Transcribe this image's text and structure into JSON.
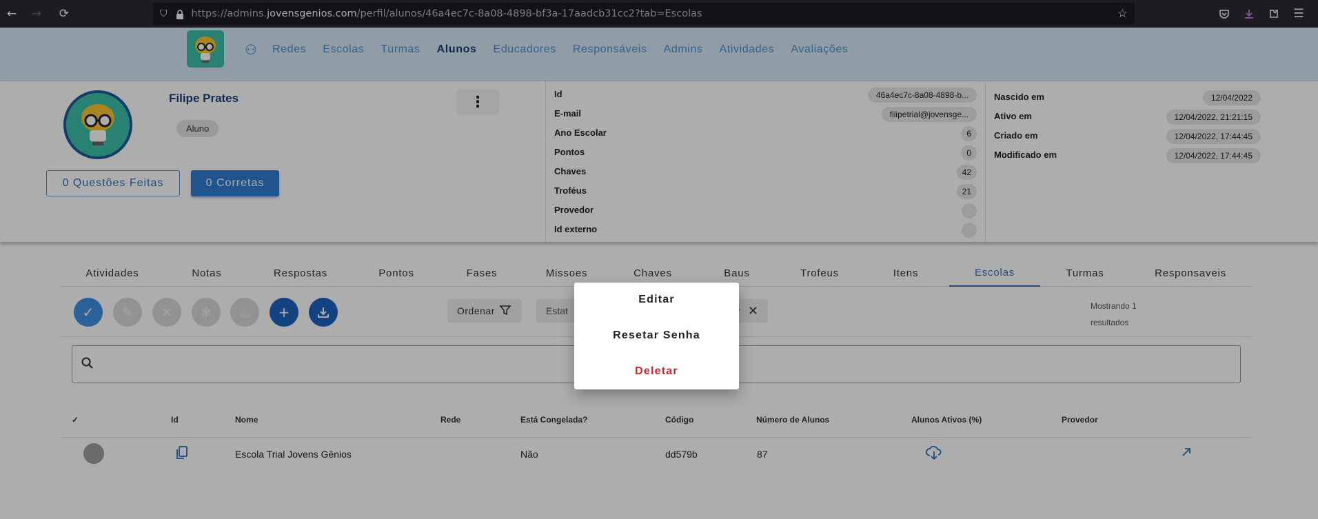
{
  "browser": {
    "url_prefix": "https://admins.",
    "url_domain": "jovensgenios.com",
    "url_path": "/perfil/alunos/46a4ec7c-8a08-4898-bf3a-17aadcb31cc2?tab=Escolas"
  },
  "nav": {
    "items": [
      "Redes",
      "Escolas",
      "Turmas",
      "Alunos",
      "Educadores",
      "Responsáveis",
      "Admins",
      "Atividades",
      "Avaliações"
    ],
    "active": "Alunos"
  },
  "profile": {
    "name": "Filipe Prates",
    "role": "Aluno",
    "questions_done": "0 Questões Feitas",
    "correct": "0 Corretas",
    "fields": [
      {
        "label": "Id",
        "value": "46a4ec7c-8a08-4898-b..."
      },
      {
        "label": "E-mail",
        "value": "filipetrial@jovensge..."
      },
      {
        "label": "Ano Escolar",
        "value": "6"
      },
      {
        "label": "Pontos",
        "value": "0"
      },
      {
        "label": "Chaves",
        "value": "42"
      },
      {
        "label": "Troféus",
        "value": "21"
      },
      {
        "label": "Provedor",
        "value": ""
      },
      {
        "label": "Id externo",
        "value": ""
      }
    ],
    "dates": [
      {
        "label": "Nascido em",
        "value": "12/04/2022"
      },
      {
        "label": "Ativo em",
        "value": "12/04/2022, 21:21:15"
      },
      {
        "label": "Criado em",
        "value": "12/04/2022, 17:44:45"
      },
      {
        "label": "Modificado em",
        "value": "12/04/2022, 17:44:45"
      }
    ]
  },
  "tabs": {
    "items": [
      "Atividades",
      "Notas",
      "Respostas",
      "Pontos",
      "Fases",
      "Missoes",
      "Chaves",
      "Baus",
      "Trofeus",
      "Itens",
      "Escolas",
      "Turmas",
      "Responsaveis"
    ],
    "active": "Escolas"
  },
  "toolbar": {
    "order_label": "Ordenar",
    "status_label": "Estat",
    "status_tail": "r",
    "showing_line1": "Mostrando 1",
    "showing_line2": "resultados"
  },
  "table": {
    "headers": [
      "✓",
      "Id",
      "Nome",
      "Rede",
      "Está Congelada?",
      "Código",
      "Número de Alunos",
      "Alunos Ativos (%)",
      "Provedor"
    ],
    "rows": [
      {
        "nome": "Escola Trial Jovens Gênios",
        "rede": "",
        "congelada": "Não",
        "codigo": "dd579b",
        "numero_alunos": "87"
      }
    ]
  },
  "dialog": {
    "edit": "Editar",
    "reset": "Resetar Senha",
    "delete": "Deletar"
  },
  "colors": {
    "primary": "#2f6eb5",
    "header_bg": "#d5e7f7",
    "danger": "#c62828"
  }
}
